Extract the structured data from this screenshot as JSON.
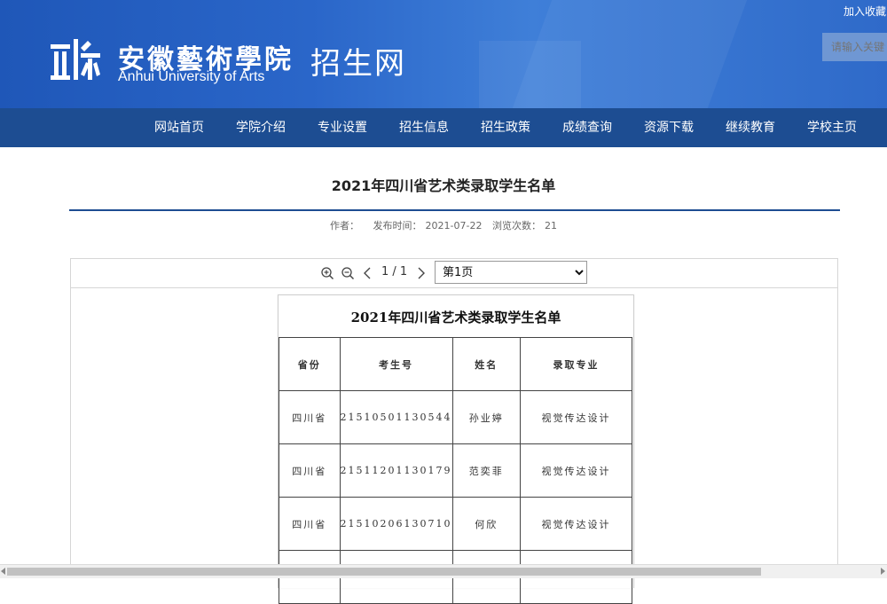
{
  "header": {
    "logo_cn": "安徽藝術學院",
    "logo_en": "Anhui University of Arts",
    "logo_suffix": "招生网",
    "favorite_link": "加入收藏",
    "search_placeholder": "请输入关键词"
  },
  "nav": {
    "items": [
      {
        "label": "网站首页"
      },
      {
        "label": "学院介绍"
      },
      {
        "label": "专业设置"
      },
      {
        "label": "招生信息"
      },
      {
        "label": "招生政策"
      },
      {
        "label": "成绩查询"
      },
      {
        "label": "资源下载"
      },
      {
        "label": "继续教育"
      },
      {
        "label": "学校主页"
      }
    ]
  },
  "article": {
    "title": "2021年四川省艺术类录取学生名单",
    "meta": {
      "author_label": "作者：",
      "author": "",
      "publish_label": "发布时间：",
      "publish_date": "2021-07-22",
      "views_label": "浏览次数：",
      "views": "21"
    }
  },
  "viewer": {
    "page_counter": "1 / 1",
    "page_select": {
      "selected": "第1页",
      "options": [
        "第1页"
      ]
    },
    "icons": [
      "zoom-in-icon",
      "zoom-out-icon",
      "chevron-left-icon",
      "chevron-right-icon"
    ]
  },
  "document": {
    "title": "2021年四川省艺术类录取学生名单",
    "headers": [
      "省份",
      "考生号",
      "姓名",
      "录取专业"
    ],
    "rows": [
      [
        "四川省",
        "21510501130544",
        "孙业婷",
        "视觉传达设计"
      ],
      [
        "四川省",
        "21511201130179",
        "范奕菲",
        "视觉传达设计"
      ],
      [
        "四川省",
        "21510206130710",
        "何欣",
        "视觉传达设计"
      ]
    ]
  },
  "colors": {
    "header_blue": "#2a66c9",
    "nav_blue": "#1d4d92",
    "rule_blue": "#1d4d92"
  }
}
